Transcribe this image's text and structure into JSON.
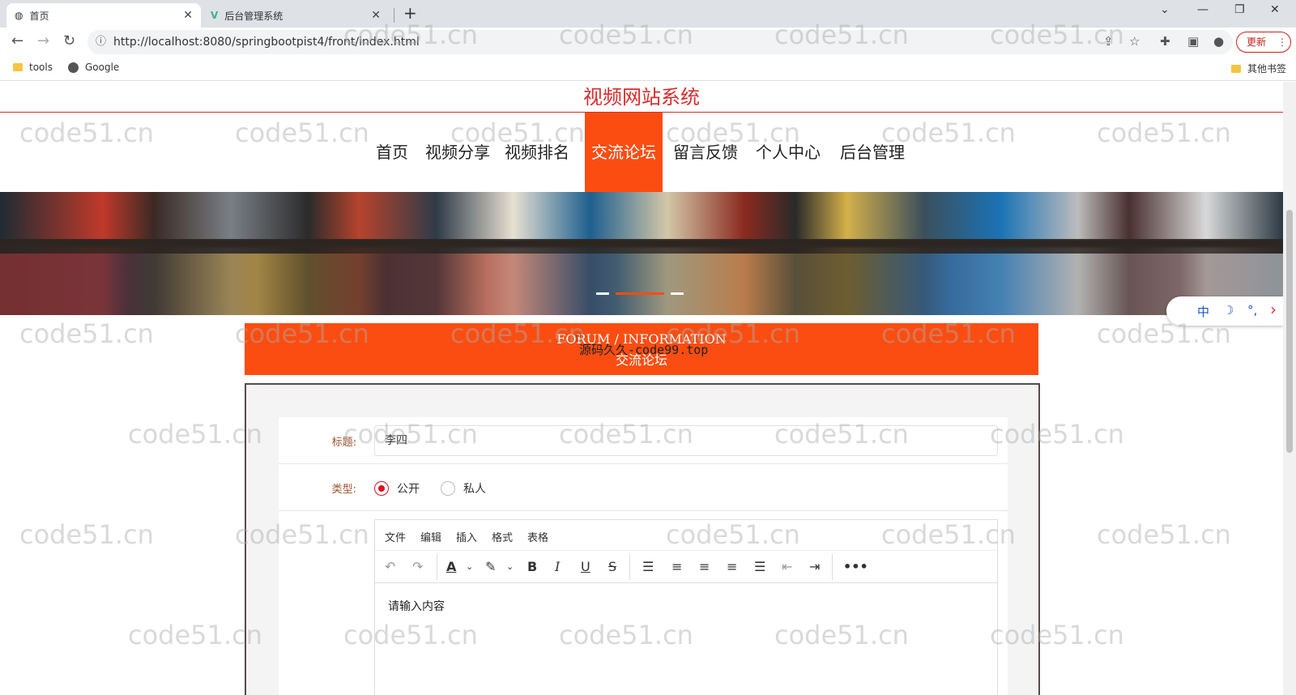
{
  "browser": {
    "tabs": [
      {
        "title": "首页",
        "active": true
      },
      {
        "title": "后台管理系统",
        "active": false
      }
    ],
    "new_tab": "+",
    "url": "http://localhost:8080/springbootpist4/front/index.html",
    "update_label": "更新",
    "bookmarks": [
      {
        "label": "tools",
        "icon": "folder-icon"
      },
      {
        "label": "Google",
        "icon": "globe-icon"
      }
    ],
    "other_bookmarks": "其他书签"
  },
  "site": {
    "title": "视频网站系统",
    "nav": [
      {
        "label": "首页",
        "active": false
      },
      {
        "label": "视频分享",
        "active": false
      },
      {
        "label": "视频排名",
        "active": false
      },
      {
        "label": "交流论坛",
        "active": true
      },
      {
        "label": "留言反馈",
        "active": false
      },
      {
        "label": "个人中心",
        "active": false
      },
      {
        "label": "后台管理",
        "active": false
      }
    ],
    "banner_slide": 2
  },
  "widget": {
    "lang": "中",
    "moon": "☽",
    "dots": "°,",
    "arrow": "›"
  },
  "section": {
    "title_en": "FORUM / INFORMATION",
    "title_cn": "交流论坛",
    "overlay": "源码久久-code99.top"
  },
  "form": {
    "title_label": "标题:",
    "title_value": "李四",
    "type_label": "类型:",
    "type_options": [
      {
        "label": "公开",
        "checked": true
      },
      {
        "label": "私人",
        "checked": false
      }
    ],
    "editor": {
      "menus": [
        "文件",
        "编辑",
        "插入",
        "格式",
        "表格"
      ],
      "placeholder": "请输入内容"
    }
  },
  "watermark": "code51.cn",
  "colors": {
    "accent": "#fb4d11",
    "title_red": "#d92b2b",
    "label_brown": "#a0522d"
  }
}
